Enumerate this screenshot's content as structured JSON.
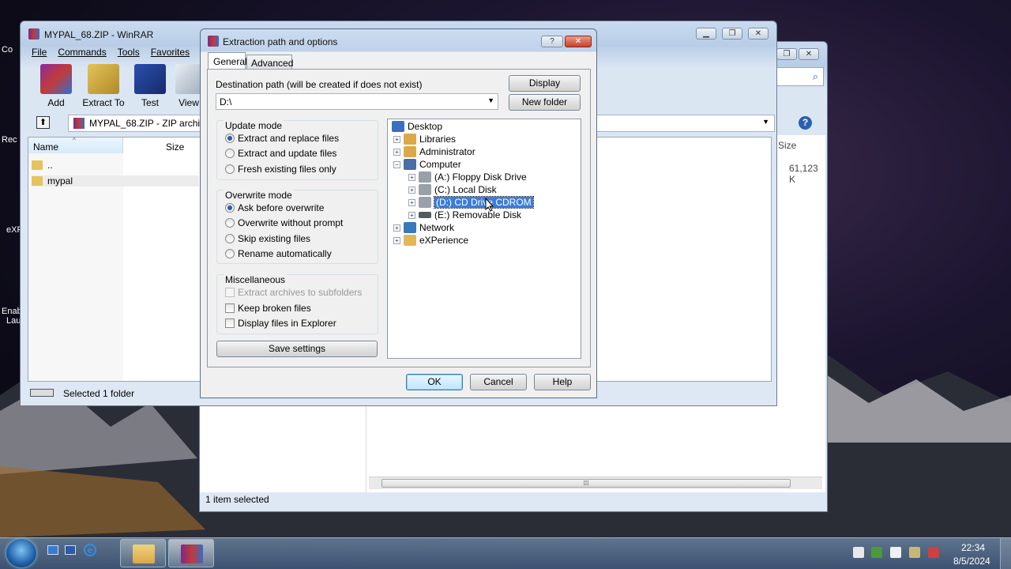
{
  "desktop": {
    "left_labels": [
      "Co",
      "Rec",
      "eXP",
      "Enab",
      "Lau"
    ]
  },
  "explorer": {
    "status": "1 item selected",
    "size_col": "Size",
    "size_value": "61,123 K"
  },
  "winrar": {
    "title": "MYPAL_68.ZIP - WinRAR",
    "menu": [
      "File",
      "Commands",
      "Tools",
      "Favorites"
    ],
    "toolbar": [
      {
        "label": "Add",
        "icon": "add-archive-icon"
      },
      {
        "label": "Extract To",
        "icon": "extract-to-icon"
      },
      {
        "label": "Test",
        "icon": "test-icon"
      },
      {
        "label": "View",
        "icon": "view-icon"
      }
    ],
    "address": "MYPAL_68.ZIP - ZIP archive",
    "columns": {
      "name": "Name",
      "size": "Size"
    },
    "rows": [
      {
        "name": ".."
      },
      {
        "name": "mypal"
      }
    ],
    "status": "Selected 1 folder"
  },
  "dialog": {
    "title": "Extraction path and options",
    "tabs": [
      "General",
      "Advanced"
    ],
    "dest_label": "Destination path (will be created if does not exist)",
    "dest_value": "D:\\",
    "display_btn": "Display",
    "newfolder_btn": "New folder",
    "update_mode": {
      "title": "Update mode",
      "options": [
        "Extract and replace files",
        "Extract and update files",
        "Fresh existing files only"
      ],
      "selected": 0
    },
    "overwrite_mode": {
      "title": "Overwrite mode",
      "options": [
        "Ask before overwrite",
        "Overwrite without prompt",
        "Skip existing files",
        "Rename automatically"
      ],
      "selected": 0
    },
    "misc": {
      "title": "Miscellaneous",
      "options": [
        {
          "label": "Extract archives to subfolders",
          "enabled": false
        },
        {
          "label": "Keep broken files",
          "enabled": true
        },
        {
          "label": "Display files in Explorer",
          "enabled": true
        }
      ]
    },
    "save_btn": "Save settings",
    "tree": [
      {
        "label": "Desktop",
        "level": 0,
        "icon": "desktop-icon",
        "color": "#3b6fbf"
      },
      {
        "label": "Libraries",
        "level": 1,
        "icon": "libraries-icon",
        "color": "#d9a94a"
      },
      {
        "label": "Administrator",
        "level": 1,
        "icon": "user-folder-icon",
        "color": "#d9a94a"
      },
      {
        "label": "Computer",
        "level": 1,
        "icon": "computer-icon",
        "color": "#4a6ea8",
        "expanded": true
      },
      {
        "label": "(A:) Floppy Disk Drive",
        "level": 2,
        "icon": "floppy-drive-icon",
        "color": "#9aa0a8"
      },
      {
        "label": "(C:) Local Disk",
        "level": 2,
        "icon": "local-disk-icon",
        "color": "#9aa0a8"
      },
      {
        "label": "(D:) CD Drive CDROM",
        "level": 2,
        "icon": "cd-drive-icon",
        "color": "#9aa0a8",
        "selected": true
      },
      {
        "label": "(E:) Removable Disk",
        "level": 2,
        "icon": "removable-disk-icon",
        "color": "#555a60"
      },
      {
        "label": "Network",
        "level": 1,
        "icon": "network-icon",
        "color": "#3a78b8"
      },
      {
        "label": "eXPerience",
        "level": 1,
        "icon": "folder-icon",
        "color": "#e2b856"
      }
    ],
    "ok": "OK",
    "cancel": "Cancel",
    "help": "Help"
  },
  "taskbar": {
    "time": "22:34",
    "date": "8/5/2024"
  }
}
